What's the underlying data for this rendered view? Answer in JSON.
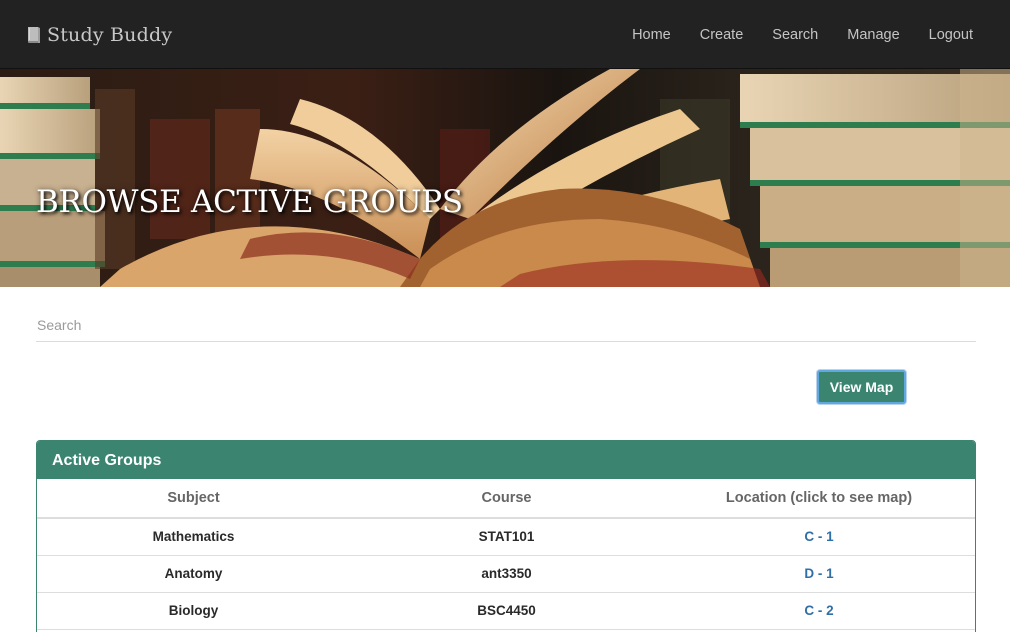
{
  "navbar": {
    "brand": "Study Buddy",
    "links": [
      "Home",
      "Create",
      "Search",
      "Manage",
      "Logout"
    ]
  },
  "hero": {
    "title": "BROWSE ACTIVE GROUPS"
  },
  "search": {
    "placeholder": "Search",
    "value": ""
  },
  "view_map_button": "View Map",
  "groups_panel": {
    "title": "Active Groups",
    "columns": [
      "Subject",
      "Course",
      "Location (click to see map)"
    ],
    "rows": [
      {
        "subject": "Mathematics",
        "course": "STAT101",
        "location": "C - 1"
      },
      {
        "subject": "Anatomy",
        "course": "ant3350",
        "location": "D - 1"
      },
      {
        "subject": "Biology",
        "course": "BSC4450",
        "location": "C - 2"
      }
    ]
  },
  "colors": {
    "navbar": "#222222",
    "accent": "#3a8470",
    "link": "#2f6fa8"
  },
  "icons": {
    "brand": "book-icon"
  }
}
